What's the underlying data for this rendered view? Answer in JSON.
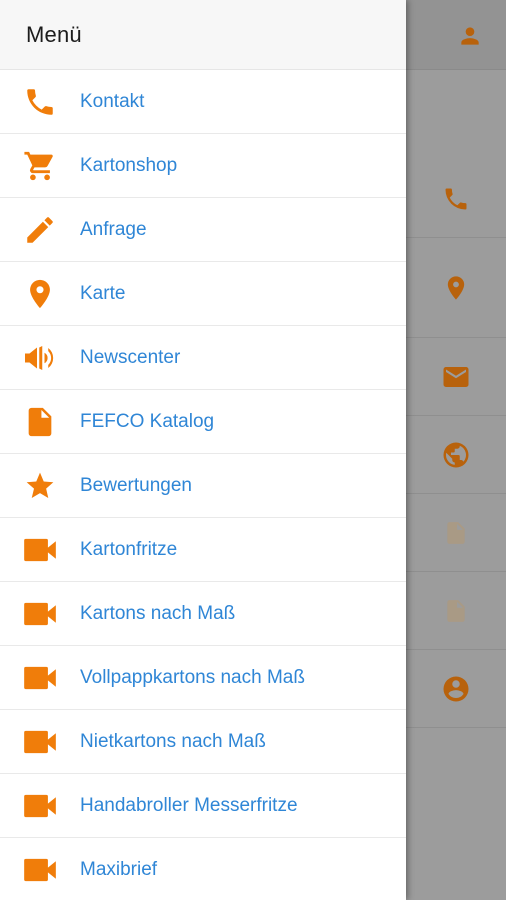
{
  "colors": {
    "accent": "#f07d0a",
    "link": "#2f86d6",
    "overlay": "#9c9c9c"
  },
  "drawer": {
    "title": "Menü",
    "items": [
      {
        "label": "Kontakt",
        "icon": "phone-icon"
      },
      {
        "label": "Kartonshop",
        "icon": "cart-icon"
      },
      {
        "label": "Anfrage",
        "icon": "pencil-icon"
      },
      {
        "label": "Karte",
        "icon": "map-pin-icon"
      },
      {
        "label": "Newscenter",
        "icon": "megaphone-icon"
      },
      {
        "label": "FEFCO Katalog",
        "icon": "document-icon"
      },
      {
        "label": "Bewertungen",
        "icon": "star-icon"
      },
      {
        "label": "Kartonfritze",
        "icon": "video-icon"
      },
      {
        "label": "Kartons nach Maß",
        "icon": "video-icon"
      },
      {
        "label": "Vollpappkartons nach Maß",
        "icon": "video-icon"
      },
      {
        "label": "Nietkartons nach Maß",
        "icon": "video-icon"
      },
      {
        "label": "Handabroller Messerfritze",
        "icon": "video-icon"
      },
      {
        "label": "Maxibrief",
        "icon": "video-icon"
      }
    ]
  },
  "background_app": {
    "header_icon": "user-icon",
    "action_icons": [
      "phone-icon",
      "map-pin-icon",
      "mail-icon",
      "globe-icon",
      "document-icon",
      "document-icon",
      "account-circle-icon"
    ]
  }
}
